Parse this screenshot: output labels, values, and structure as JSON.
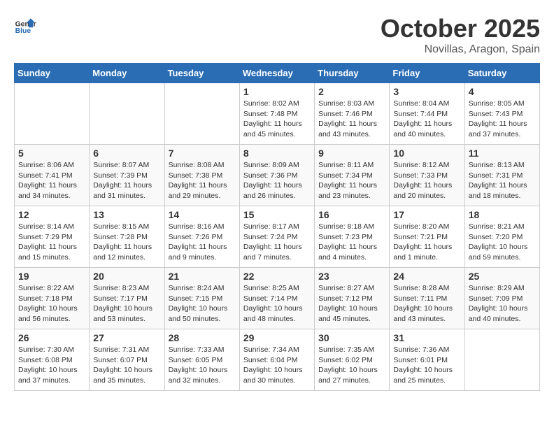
{
  "header": {
    "logo_line1": "General",
    "logo_line2": "Blue",
    "title": "October 2025",
    "subtitle": "Novillas, Aragon, Spain"
  },
  "days_of_week": [
    "Sunday",
    "Monday",
    "Tuesday",
    "Wednesday",
    "Thursday",
    "Friday",
    "Saturday"
  ],
  "weeks": [
    [
      {
        "day": "",
        "info": ""
      },
      {
        "day": "",
        "info": ""
      },
      {
        "day": "",
        "info": ""
      },
      {
        "day": "1",
        "info": "Sunrise: 8:02 AM\nSunset: 7:48 PM\nDaylight: 11 hours\nand 45 minutes."
      },
      {
        "day": "2",
        "info": "Sunrise: 8:03 AM\nSunset: 7:46 PM\nDaylight: 11 hours\nand 43 minutes."
      },
      {
        "day": "3",
        "info": "Sunrise: 8:04 AM\nSunset: 7:44 PM\nDaylight: 11 hours\nand 40 minutes."
      },
      {
        "day": "4",
        "info": "Sunrise: 8:05 AM\nSunset: 7:43 PM\nDaylight: 11 hours\nand 37 minutes."
      }
    ],
    [
      {
        "day": "5",
        "info": "Sunrise: 8:06 AM\nSunset: 7:41 PM\nDaylight: 11 hours\nand 34 minutes."
      },
      {
        "day": "6",
        "info": "Sunrise: 8:07 AM\nSunset: 7:39 PM\nDaylight: 11 hours\nand 31 minutes."
      },
      {
        "day": "7",
        "info": "Sunrise: 8:08 AM\nSunset: 7:38 PM\nDaylight: 11 hours\nand 29 minutes."
      },
      {
        "day": "8",
        "info": "Sunrise: 8:09 AM\nSunset: 7:36 PM\nDaylight: 11 hours\nand 26 minutes."
      },
      {
        "day": "9",
        "info": "Sunrise: 8:11 AM\nSunset: 7:34 PM\nDaylight: 11 hours\nand 23 minutes."
      },
      {
        "day": "10",
        "info": "Sunrise: 8:12 AM\nSunset: 7:33 PM\nDaylight: 11 hours\nand 20 minutes."
      },
      {
        "day": "11",
        "info": "Sunrise: 8:13 AM\nSunset: 7:31 PM\nDaylight: 11 hours\nand 18 minutes."
      }
    ],
    [
      {
        "day": "12",
        "info": "Sunrise: 8:14 AM\nSunset: 7:29 PM\nDaylight: 11 hours\nand 15 minutes."
      },
      {
        "day": "13",
        "info": "Sunrise: 8:15 AM\nSunset: 7:28 PM\nDaylight: 11 hours\nand 12 minutes."
      },
      {
        "day": "14",
        "info": "Sunrise: 8:16 AM\nSunset: 7:26 PM\nDaylight: 11 hours\nand 9 minutes."
      },
      {
        "day": "15",
        "info": "Sunrise: 8:17 AM\nSunset: 7:24 PM\nDaylight: 11 hours\nand 7 minutes."
      },
      {
        "day": "16",
        "info": "Sunrise: 8:18 AM\nSunset: 7:23 PM\nDaylight: 11 hours\nand 4 minutes."
      },
      {
        "day": "17",
        "info": "Sunrise: 8:20 AM\nSunset: 7:21 PM\nDaylight: 11 hours\nand 1 minute."
      },
      {
        "day": "18",
        "info": "Sunrise: 8:21 AM\nSunset: 7:20 PM\nDaylight: 10 hours\nand 59 minutes."
      }
    ],
    [
      {
        "day": "19",
        "info": "Sunrise: 8:22 AM\nSunset: 7:18 PM\nDaylight: 10 hours\nand 56 minutes."
      },
      {
        "day": "20",
        "info": "Sunrise: 8:23 AM\nSunset: 7:17 PM\nDaylight: 10 hours\nand 53 minutes."
      },
      {
        "day": "21",
        "info": "Sunrise: 8:24 AM\nSunset: 7:15 PM\nDaylight: 10 hours\nand 50 minutes."
      },
      {
        "day": "22",
        "info": "Sunrise: 8:25 AM\nSunset: 7:14 PM\nDaylight: 10 hours\nand 48 minutes."
      },
      {
        "day": "23",
        "info": "Sunrise: 8:27 AM\nSunset: 7:12 PM\nDaylight: 10 hours\nand 45 minutes."
      },
      {
        "day": "24",
        "info": "Sunrise: 8:28 AM\nSunset: 7:11 PM\nDaylight: 10 hours\nand 43 minutes."
      },
      {
        "day": "25",
        "info": "Sunrise: 8:29 AM\nSunset: 7:09 PM\nDaylight: 10 hours\nand 40 minutes."
      }
    ],
    [
      {
        "day": "26",
        "info": "Sunrise: 7:30 AM\nSunset: 6:08 PM\nDaylight: 10 hours\nand 37 minutes."
      },
      {
        "day": "27",
        "info": "Sunrise: 7:31 AM\nSunset: 6:07 PM\nDaylight: 10 hours\nand 35 minutes."
      },
      {
        "day": "28",
        "info": "Sunrise: 7:33 AM\nSunset: 6:05 PM\nDaylight: 10 hours\nand 32 minutes."
      },
      {
        "day": "29",
        "info": "Sunrise: 7:34 AM\nSunset: 6:04 PM\nDaylight: 10 hours\nand 30 minutes."
      },
      {
        "day": "30",
        "info": "Sunrise: 7:35 AM\nSunset: 6:02 PM\nDaylight: 10 hours\nand 27 minutes."
      },
      {
        "day": "31",
        "info": "Sunrise: 7:36 AM\nSunset: 6:01 PM\nDaylight: 10 hours\nand 25 minutes."
      },
      {
        "day": "",
        "info": ""
      }
    ]
  ]
}
